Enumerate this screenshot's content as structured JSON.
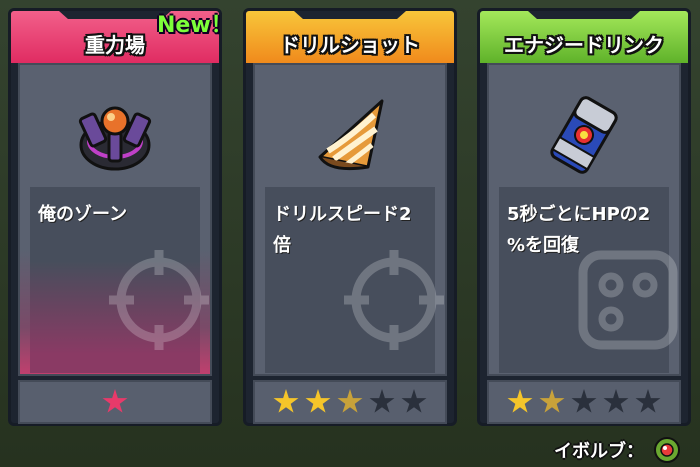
{
  "cards": [
    {
      "title": "重力場",
      "badge": "New！",
      "description": "俺のゾーン",
      "header_color": "#e8386a",
      "icon": "gravity-field-icon",
      "stars": 1,
      "max_stars": 1,
      "star_color": "#e83a6a"
    },
    {
      "title": "ドリルショット",
      "description": "ドリルスピード2\n倍",
      "header_color": "#f3a523",
      "icon": "drill-icon",
      "stars": 3,
      "max_stars": 5,
      "star_color": "#f5c52a"
    },
    {
      "title": "エナジードリンク",
      "description": "5秒ごとにHPの2\n%を回復",
      "header_color": "#7ac93a",
      "icon": "energy-can-icon",
      "stars": 2,
      "max_stars": 5,
      "star_color": "#f5c52a"
    }
  ],
  "footer": {
    "evolve_label": "イボルブ：",
    "evolve_icon": "evolve-orb-icon"
  }
}
